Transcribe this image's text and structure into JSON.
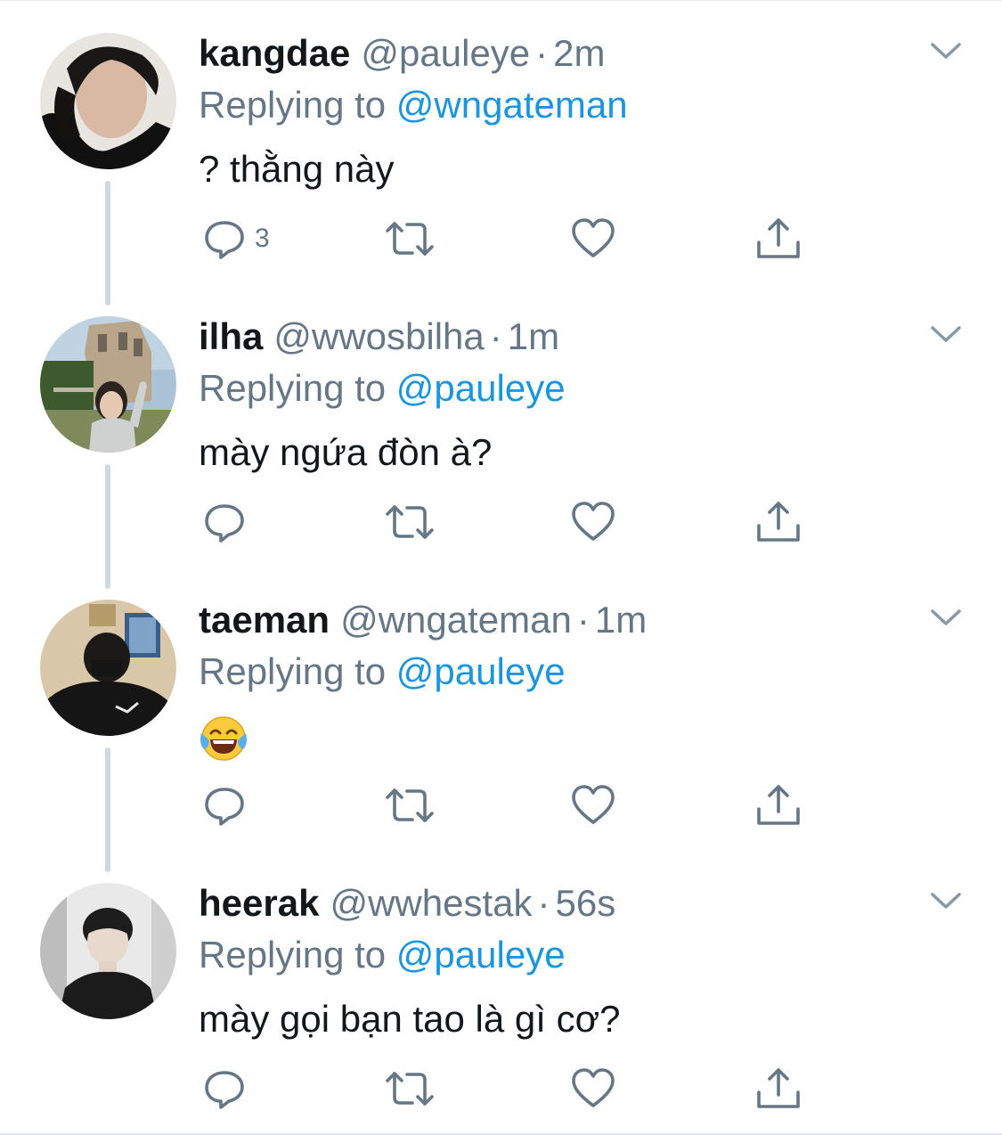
{
  "colors": {
    "text": "#14171a",
    "secondary": "#657786",
    "link": "#1b95e0",
    "thread_line": "#cfd9de",
    "divider": "#e6ecf0"
  },
  "tweets": [
    {
      "display_name": "kangdae",
      "handle": "@pauleye",
      "separator": "·",
      "time": "2m",
      "replying_prefix": "Replying to",
      "replying_to": "@wngateman",
      "text": "? thằng này",
      "reply_count": "3",
      "avatar_icon": "avatar-photo"
    },
    {
      "display_name": "ilha",
      "handle": "@wwosbilha",
      "separator": "·",
      "time": "1m",
      "replying_prefix": "Replying to",
      "replying_to": "@pauleye",
      "text": "mày ngứa đòn à?",
      "reply_count": "",
      "avatar_icon": "avatar-photo"
    },
    {
      "display_name": "taeman",
      "handle": "@wngateman",
      "separator": "·",
      "time": "1m",
      "replying_prefix": "Replying to",
      "replying_to": "@pauleye",
      "text": "😂",
      "reply_count": "",
      "avatar_icon": "avatar-photo"
    },
    {
      "display_name": "heerak",
      "handle": "@wwhestak",
      "separator": "·",
      "time": "56s",
      "replying_prefix": "Replying to",
      "replying_to": "@pauleye",
      "text": "mày gọi bạn tao là gì cơ?",
      "reply_count": "",
      "avatar_icon": "avatar-photo"
    }
  ],
  "icons": {
    "reply": "reply-icon",
    "retweet": "retweet-icon",
    "like": "heart-icon",
    "share": "share-icon",
    "more": "chevron-down-icon",
    "emoji": "face-with-tears-of-joy-icon"
  }
}
